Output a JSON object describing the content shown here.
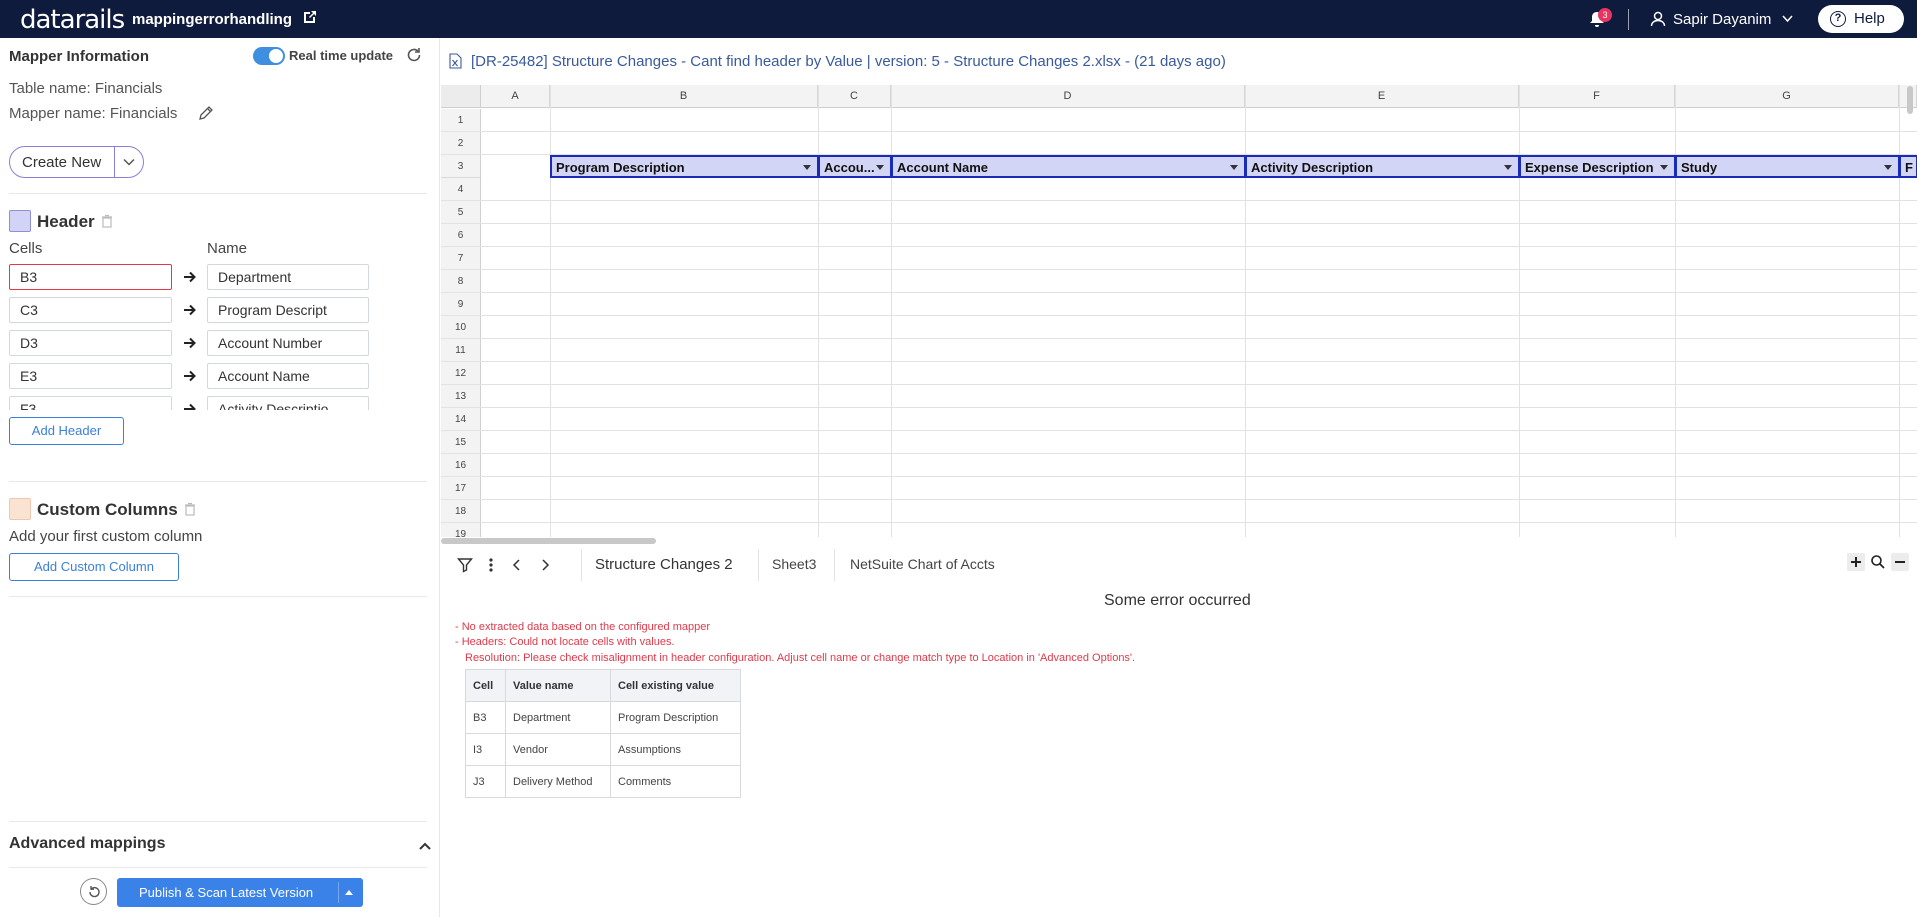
{
  "topbar": {
    "logo": "datarails",
    "app_name": "mappingerrorhandling",
    "notif_count": "3",
    "user_name": "Sapir Dayanim",
    "help_label": "Help"
  },
  "mapper": {
    "title": "Mapper Information",
    "realtime_label": "Real time update",
    "realtime_on": true,
    "table_name": "Table name: Financials",
    "mapper_name": "Mapper name: Financials",
    "create_new_label": "Create New"
  },
  "header_section": {
    "title": "Header",
    "swatch_color": "#d3d3f7",
    "cells_col": "Cells",
    "name_col": "Name",
    "rows": [
      {
        "cell": "B3",
        "name": "Department",
        "error": true
      },
      {
        "cell": "C3",
        "name": "Program Descript",
        "error": false
      },
      {
        "cell": "D3",
        "name": "Account Number",
        "error": false
      },
      {
        "cell": "E3",
        "name": "Account Name",
        "error": false
      },
      {
        "cell": "F3",
        "name": "Activity Descriptio",
        "error": false
      }
    ],
    "add_label": "Add Header"
  },
  "custom_section": {
    "title": "Custom Columns",
    "swatch_color": "#fbe3d3",
    "hint": "Add your first custom column",
    "add_label": "Add Custom Column"
  },
  "advanced": {
    "title": "Advanced mappings"
  },
  "footer": {
    "publish_label": "Publish & Scan Latest Version"
  },
  "file": {
    "title": "[DR-25482] Structure Changes - Cant find header by Value | version: 5 - Structure Changes 2.xlsx - (21 days ago)"
  },
  "sheet": {
    "columns": [
      "A",
      "B",
      "C",
      "D",
      "E",
      "F",
      "G"
    ],
    "rows": [
      "1",
      "2",
      "3",
      "4",
      "5",
      "6",
      "7",
      "8",
      "9",
      "10",
      "11",
      "12",
      "13",
      "14",
      "15",
      "16",
      "17",
      "18",
      "19"
    ],
    "header_cells": [
      "Program Description",
      "Accou...",
      "Account Name",
      "Activity Description",
      "Expense Description",
      "Study",
      "F"
    ]
  },
  "tabs": {
    "items": [
      "Structure Changes 2",
      "Sheet3",
      "NetSuite Chart of Accts"
    ],
    "active": "Structure Changes 2"
  },
  "error": {
    "title": "Some error occurred",
    "lines": [
      "- No extracted data based on the configured mapper",
      "- Headers: Could not locate cells with values.",
      "Resolution: Please check misalignment in header configuration. Adjust cell name or change match type to Location in 'Advanced Options'."
    ],
    "table_headers": [
      "Cell",
      "Value name",
      "Cell existing value"
    ],
    "table_rows": [
      [
        "B3",
        "Department",
        "Program Description"
      ],
      [
        "I3",
        "Vendor",
        "Assumptions"
      ],
      [
        "J3",
        "Delivery Method",
        "Comments"
      ]
    ]
  },
  "colors": {
    "topbar_bg": "#0f1b3d",
    "accent": "#3b82e8",
    "error": "#e0394a",
    "header_highlight": "#d3d5f6"
  }
}
